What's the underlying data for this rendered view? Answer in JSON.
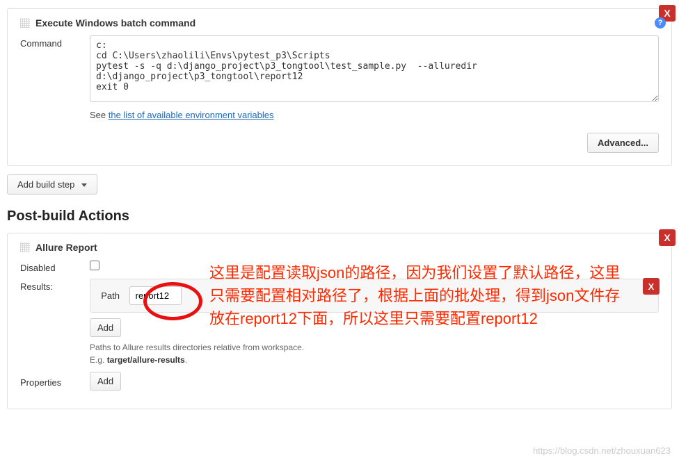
{
  "execSection": {
    "title": "Execute Windows batch command",
    "commandLabel": "Command",
    "commandValue": "c:\ncd C:\\Users\\zhaolili\\Envs\\pytest_p3\\Scripts\npytest -s -q d:\\django_project\\p3_tongtool\\test_sample.py  --alluredir d:\\django_project\\p3_tongtool\\report12\nexit 0",
    "seePrefix": "See ",
    "envLink": "the list of available environment variables",
    "advanced": "Advanced...",
    "close": "X",
    "help": "?"
  },
  "addStep": {
    "label": "Add build step"
  },
  "postBuild": {
    "heading": "Post-build Actions"
  },
  "allure": {
    "title": "Allure Report",
    "close": "X",
    "disabledLabel": "Disabled",
    "resultsLabel": "Results:",
    "pathLabel": "Path",
    "pathValue": "report12",
    "add": "Add",
    "hint1": "Paths to Allure results directories relative from workspace.",
    "hint2a": "E.g. ",
    "hint2b": "target/allure-results",
    "hint2c": ".",
    "propertiesLabel": "Properties",
    "innerClose": "X"
  },
  "annotation": {
    "text": "这里是配置读取json的路径，因为我们设置了默认路径，这里只需要配置相对路径了，根据上面的批处理，得到json文件存放在report12下面，所以这里只需要配置report12"
  },
  "watermark": "https://blog.csdn.net/zhouxuan623"
}
